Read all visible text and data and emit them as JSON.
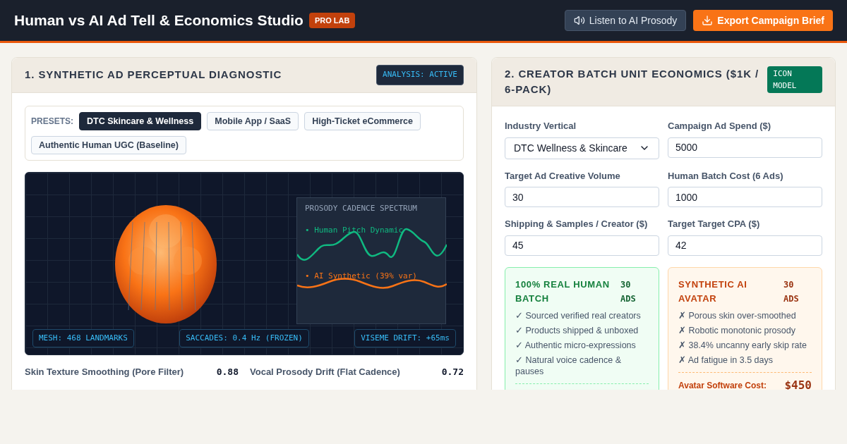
{
  "header": {
    "title": "Human vs AI Ad Tell & Economics Studio",
    "badge": "PRO LAB",
    "buttons": [
      {
        "kind": "audio",
        "label": "Listen to AI Prosody"
      },
      {
        "kind": "export",
        "label": "Export Campaign Brief"
      }
    ]
  },
  "diagnostic": {
    "title": "1. SYNTHETIC AD PERCEPTUAL DIAGNOSTIC",
    "status": "ANALYSIS: ACTIVE",
    "presets_label": "PRESETS:",
    "presets": [
      {
        "label": "DTC Skincare & Wellness",
        "selected": true
      },
      {
        "label": "Mobile App / SaaS",
        "selected": false
      },
      {
        "label": "High-Ticket eCommerce",
        "selected": false
      },
      {
        "label": "Authentic Human UGC (Baseline)",
        "selected": false
      }
    ],
    "spectrum": {
      "title": "PROSODY CADENCE SPECTRUM",
      "human_legend": "• Human Pitch Dynamic",
      "ai_legend": "• AI Synthetic (39% var)"
    },
    "readouts": [
      "MESH: 468 LANDMARKS",
      "SACCADES: 0.4 Hz (FROZEN)",
      "VISEME DRIFT: +65ms"
    ],
    "metrics": [
      {
        "label": "Skin Texture Smoothing (Pore Filter)",
        "value": "0.88"
      },
      {
        "label": "Vocal Prosody Drift (Flat Cadence)",
        "value": "0.72"
      }
    ]
  },
  "economics": {
    "title": "2. CREATOR BATCH UNIT ECONOMICS ($1K / 6-PACK)",
    "badge": "ICON MODEL",
    "fields": [
      {
        "kind": "select",
        "label": "Industry Vertical",
        "value": "DTC Wellness & Skincare"
      },
      {
        "kind": "input",
        "label": "Campaign Ad Spend ($)",
        "value": "5000"
      },
      {
        "kind": "input",
        "label": "Target Ad Creative Volume",
        "value": "30"
      },
      {
        "kind": "input",
        "label": "Human Batch Cost (6 Ads)",
        "value": "1000"
      },
      {
        "kind": "input",
        "label": "Shipping & Samples / Creator ($)",
        "value": "45"
      },
      {
        "kind": "input",
        "label": "Target Target CPA ($)",
        "value": "42"
      }
    ],
    "cards": [
      {
        "kind": "human",
        "title": "100% REAL HUMAN BATCH",
        "count": "30 ADS",
        "items": [
          "✓ Sourced verified real creators",
          "✓ Products shipped & unboxed",
          "✓ Authentic micro-expressions",
          "✓ Natural voice cadence & pauses"
        ]
      },
      {
        "kind": "ai",
        "title": "SYNTHETIC AI AVATAR",
        "count": "30 ADS",
        "items": [
          "✗ Porous skin over-smoothed",
          "✗ Robotic monotonic prosody",
          "✗ 38.4% uncanny early skip rate",
          "✗ Ad fatigue in 3.5 days"
        ],
        "cost_label": "Avatar Software Cost:",
        "cost": "$450"
      }
    ]
  }
}
